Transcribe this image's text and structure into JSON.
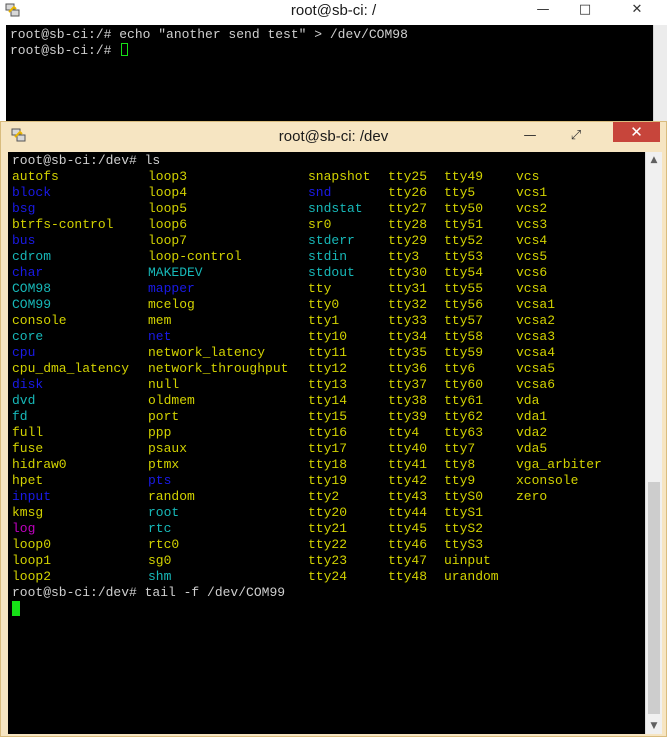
{
  "colors": {
    "yellow": "#d2d200",
    "blue": "#1a1ae6",
    "cyan": "#17b8b8",
    "magenta": "#c000c0",
    "cursor": "#16e016"
  },
  "back_window": {
    "title": "root@sb-ci: /",
    "icon": "putty-icon",
    "controls": {
      "minimize": "—",
      "maximize": "□",
      "close": "✕"
    },
    "lines": [
      "root@sb-ci:/# echo \"another send test\" > /dev/COM98",
      "root@sb-ci:/# "
    ]
  },
  "front_window": {
    "title": "root@sb-ci: /dev",
    "icon": "putty-icon",
    "controls": {
      "minimize": "—",
      "maximize": "⤢",
      "close": "✕"
    },
    "prompt_ls": "root@sb-ci:/dev# ls",
    "prompt_tail": "root@sb-ci:/dev# tail -f /dev/COM99",
    "ls_columns": [
      [
        {
          "n": "autofs",
          "c": "yellow"
        },
        {
          "n": "block",
          "c": "blue"
        },
        {
          "n": "bsg",
          "c": "blue"
        },
        {
          "n": "btrfs-control",
          "c": "yellow"
        },
        {
          "n": "bus",
          "c": "blue"
        },
        {
          "n": "cdrom",
          "c": "cyan"
        },
        {
          "n": "char",
          "c": "blue"
        },
        {
          "n": "COM98",
          "c": "cyan"
        },
        {
          "n": "COM99",
          "c": "cyan"
        },
        {
          "n": "console",
          "c": "yellow"
        },
        {
          "n": "core",
          "c": "cyan"
        },
        {
          "n": "cpu",
          "c": "blue"
        },
        {
          "n": "cpu_dma_latency",
          "c": "yellow"
        },
        {
          "n": "disk",
          "c": "blue"
        },
        {
          "n": "dvd",
          "c": "cyan"
        },
        {
          "n": "fd",
          "c": "cyan"
        },
        {
          "n": "full",
          "c": "yellow"
        },
        {
          "n": "fuse",
          "c": "yellow"
        },
        {
          "n": "hidraw0",
          "c": "yellow"
        },
        {
          "n": "hpet",
          "c": "yellow"
        },
        {
          "n": "input",
          "c": "blue"
        },
        {
          "n": "kmsg",
          "c": "yellow"
        },
        {
          "n": "log",
          "c": "magenta"
        },
        {
          "n": "loop0",
          "c": "yellow"
        },
        {
          "n": "loop1",
          "c": "yellow"
        },
        {
          "n": "loop2",
          "c": "yellow"
        }
      ],
      [
        {
          "n": "loop3",
          "c": "yellow"
        },
        {
          "n": "loop4",
          "c": "yellow"
        },
        {
          "n": "loop5",
          "c": "yellow"
        },
        {
          "n": "loop6",
          "c": "yellow"
        },
        {
          "n": "loop7",
          "c": "yellow"
        },
        {
          "n": "loop-control",
          "c": "yellow"
        },
        {
          "n": "MAKEDEV",
          "c": "cyan"
        },
        {
          "n": "mapper",
          "c": "blue"
        },
        {
          "n": "mcelog",
          "c": "yellow"
        },
        {
          "n": "mem",
          "c": "yellow"
        },
        {
          "n": "net",
          "c": "blue"
        },
        {
          "n": "network_latency",
          "c": "yellow"
        },
        {
          "n": "network_throughput",
          "c": "yellow"
        },
        {
          "n": "null",
          "c": "yellow"
        },
        {
          "n": "oldmem",
          "c": "yellow"
        },
        {
          "n": "port",
          "c": "yellow"
        },
        {
          "n": "ppp",
          "c": "yellow"
        },
        {
          "n": "psaux",
          "c": "yellow"
        },
        {
          "n": "ptmx",
          "c": "yellow"
        },
        {
          "n": "pts",
          "c": "blue"
        },
        {
          "n": "random",
          "c": "yellow"
        },
        {
          "n": "root",
          "c": "cyan"
        },
        {
          "n": "rtc",
          "c": "cyan"
        },
        {
          "n": "rtc0",
          "c": "yellow"
        },
        {
          "n": "sg0",
          "c": "yellow"
        },
        {
          "n": "shm",
          "c": "cyan"
        }
      ],
      [
        {
          "n": "snapshot",
          "c": "yellow"
        },
        {
          "n": "snd",
          "c": "blue"
        },
        {
          "n": "sndstat",
          "c": "cyan"
        },
        {
          "n": "sr0",
          "c": "yellow"
        },
        {
          "n": "stderr",
          "c": "cyan"
        },
        {
          "n": "stdin",
          "c": "cyan"
        },
        {
          "n": "stdout",
          "c": "cyan"
        },
        {
          "n": "tty",
          "c": "yellow"
        },
        {
          "n": "tty0",
          "c": "yellow"
        },
        {
          "n": "tty1",
          "c": "yellow"
        },
        {
          "n": "tty10",
          "c": "yellow"
        },
        {
          "n": "tty11",
          "c": "yellow"
        },
        {
          "n": "tty12",
          "c": "yellow"
        },
        {
          "n": "tty13",
          "c": "yellow"
        },
        {
          "n": "tty14",
          "c": "yellow"
        },
        {
          "n": "tty15",
          "c": "yellow"
        },
        {
          "n": "tty16",
          "c": "yellow"
        },
        {
          "n": "tty17",
          "c": "yellow"
        },
        {
          "n": "tty18",
          "c": "yellow"
        },
        {
          "n": "tty19",
          "c": "yellow"
        },
        {
          "n": "tty2",
          "c": "yellow"
        },
        {
          "n": "tty20",
          "c": "yellow"
        },
        {
          "n": "tty21",
          "c": "yellow"
        },
        {
          "n": "tty22",
          "c": "yellow"
        },
        {
          "n": "tty23",
          "c": "yellow"
        },
        {
          "n": "tty24",
          "c": "yellow"
        }
      ],
      [
        {
          "n": "tty25",
          "c": "yellow"
        },
        {
          "n": "tty26",
          "c": "yellow"
        },
        {
          "n": "tty27",
          "c": "yellow"
        },
        {
          "n": "tty28",
          "c": "yellow"
        },
        {
          "n": "tty29",
          "c": "yellow"
        },
        {
          "n": "tty3",
          "c": "yellow"
        },
        {
          "n": "tty30",
          "c": "yellow"
        },
        {
          "n": "tty31",
          "c": "yellow"
        },
        {
          "n": "tty32",
          "c": "yellow"
        },
        {
          "n": "tty33",
          "c": "yellow"
        },
        {
          "n": "tty34",
          "c": "yellow"
        },
        {
          "n": "tty35",
          "c": "yellow"
        },
        {
          "n": "tty36",
          "c": "yellow"
        },
        {
          "n": "tty37",
          "c": "yellow"
        },
        {
          "n": "tty38",
          "c": "yellow"
        },
        {
          "n": "tty39",
          "c": "yellow"
        },
        {
          "n": "tty4",
          "c": "yellow"
        },
        {
          "n": "tty40",
          "c": "yellow"
        },
        {
          "n": "tty41",
          "c": "yellow"
        },
        {
          "n": "tty42",
          "c": "yellow"
        },
        {
          "n": "tty43",
          "c": "yellow"
        },
        {
          "n": "tty44",
          "c": "yellow"
        },
        {
          "n": "tty45",
          "c": "yellow"
        },
        {
          "n": "tty46",
          "c": "yellow"
        },
        {
          "n": "tty47",
          "c": "yellow"
        },
        {
          "n": "tty48",
          "c": "yellow"
        }
      ],
      [
        {
          "n": "tty49",
          "c": "yellow"
        },
        {
          "n": "tty5",
          "c": "yellow"
        },
        {
          "n": "tty50",
          "c": "yellow"
        },
        {
          "n": "tty51",
          "c": "yellow"
        },
        {
          "n": "tty52",
          "c": "yellow"
        },
        {
          "n": "tty53",
          "c": "yellow"
        },
        {
          "n": "tty54",
          "c": "yellow"
        },
        {
          "n": "tty55",
          "c": "yellow"
        },
        {
          "n": "tty56",
          "c": "yellow"
        },
        {
          "n": "tty57",
          "c": "yellow"
        },
        {
          "n": "tty58",
          "c": "yellow"
        },
        {
          "n": "tty59",
          "c": "yellow"
        },
        {
          "n": "tty6",
          "c": "yellow"
        },
        {
          "n": "tty60",
          "c": "yellow"
        },
        {
          "n": "tty61",
          "c": "yellow"
        },
        {
          "n": "tty62",
          "c": "yellow"
        },
        {
          "n": "tty63",
          "c": "yellow"
        },
        {
          "n": "tty7",
          "c": "yellow"
        },
        {
          "n": "tty8",
          "c": "yellow"
        },
        {
          "n": "tty9",
          "c": "yellow"
        },
        {
          "n": "ttyS0",
          "c": "yellow"
        },
        {
          "n": "ttyS1",
          "c": "yellow"
        },
        {
          "n": "ttyS2",
          "c": "yellow"
        },
        {
          "n": "ttyS3",
          "c": "yellow"
        },
        {
          "n": "uinput",
          "c": "yellow"
        },
        {
          "n": "urandom",
          "c": "yellow"
        }
      ],
      [
        {
          "n": "vcs",
          "c": "yellow"
        },
        {
          "n": "vcs1",
          "c": "yellow"
        },
        {
          "n": "vcs2",
          "c": "yellow"
        },
        {
          "n": "vcs3",
          "c": "yellow"
        },
        {
          "n": "vcs4",
          "c": "yellow"
        },
        {
          "n": "vcs5",
          "c": "yellow"
        },
        {
          "n": "vcs6",
          "c": "yellow"
        },
        {
          "n": "vcsa",
          "c": "yellow"
        },
        {
          "n": "vcsa1",
          "c": "yellow"
        },
        {
          "n": "vcsa2",
          "c": "yellow"
        },
        {
          "n": "vcsa3",
          "c": "yellow"
        },
        {
          "n": "vcsa4",
          "c": "yellow"
        },
        {
          "n": "vcsa5",
          "c": "yellow"
        },
        {
          "n": "vcsa6",
          "c": "yellow"
        },
        {
          "n": "vda",
          "c": "yellow"
        },
        {
          "n": "vda1",
          "c": "yellow"
        },
        {
          "n": "vda2",
          "c": "yellow"
        },
        {
          "n": "vda5",
          "c": "yellow"
        },
        {
          "n": "vga_arbiter",
          "c": "yellow"
        },
        {
          "n": "xconsole",
          "c": "yellow"
        },
        {
          "n": "zero",
          "c": "yellow"
        }
      ]
    ]
  }
}
